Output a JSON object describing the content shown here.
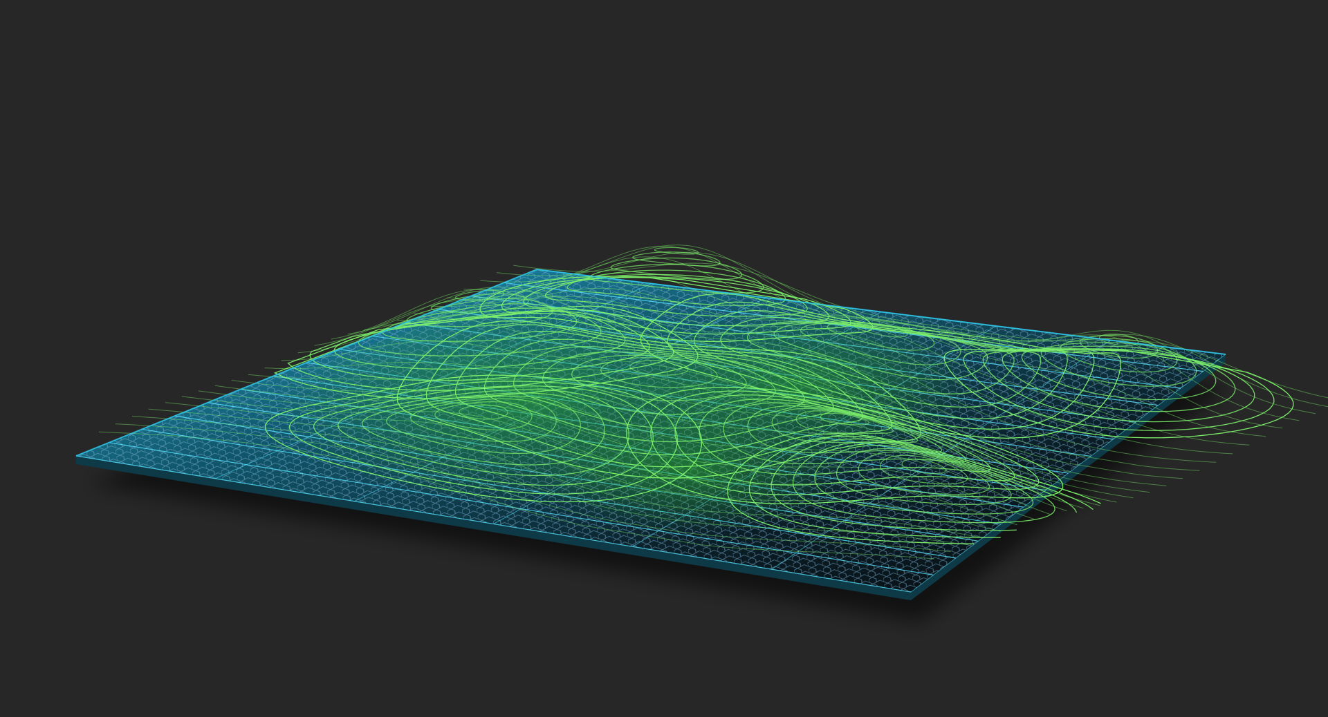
{
  "scene": {
    "background_color": "#272727",
    "plate_color": "#1ba3c8",
    "plate_edge_color": "#2bc2e6",
    "hex_color": "#7fb3d6",
    "grid_color": "#56e3ff",
    "grid_shadow_color": "#0b0e12",
    "contour_color": "#7cf06a",
    "contour_glow_color": "#2fa62a",
    "objects": [
      "base-plate",
      "hex-mesh",
      "grid-lines",
      "contour-surface",
      "drop-shadow"
    ]
  }
}
